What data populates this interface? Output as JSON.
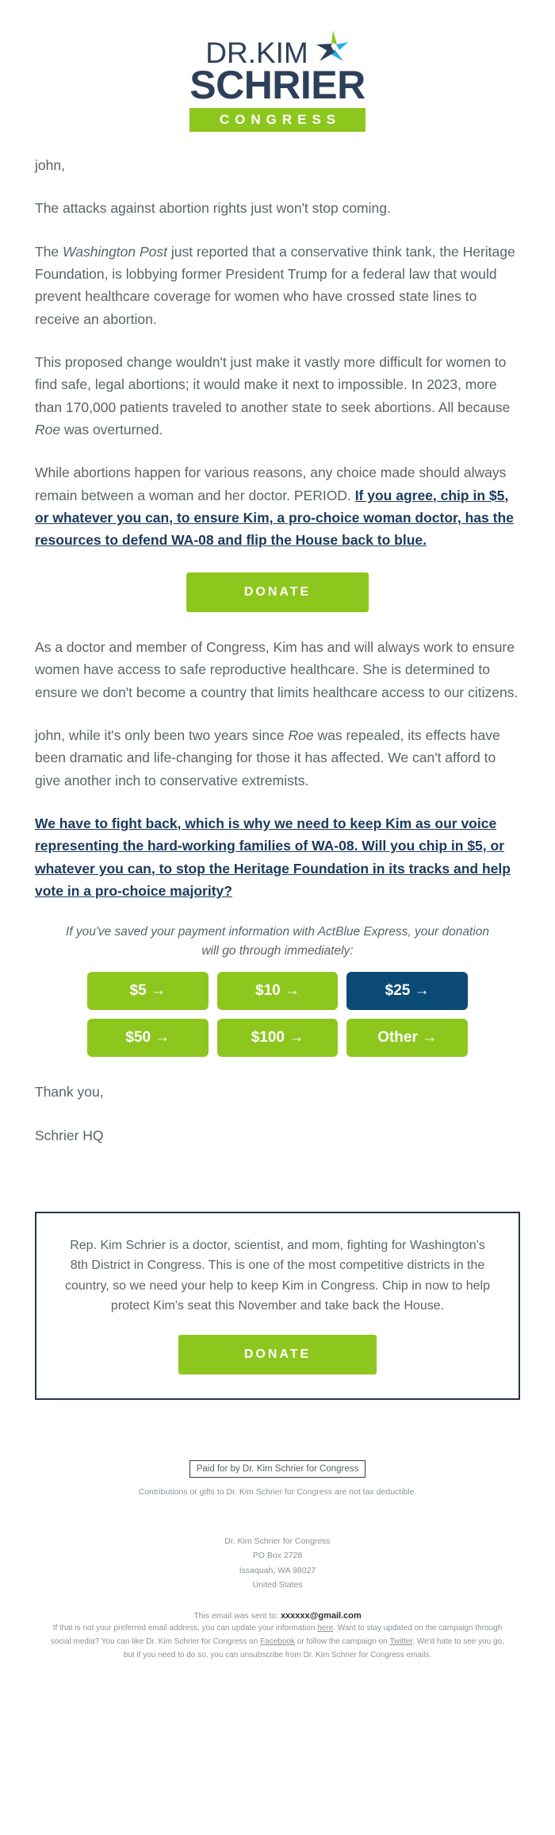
{
  "logo": {
    "line1": "DR.KIM",
    "line2": "SCHRIER",
    "bar": "CONGRESS",
    "star_icon": "star-icon",
    "navy": "#2d4059",
    "green": "#8dc71e",
    "cyan": "#29ABE2",
    "star_green": "#8dc71e"
  },
  "body": {
    "greeting": "john,",
    "p1": "The attacks against abortion rights just won't stop coming.",
    "p2_a": "The ",
    "p2_em": "Washington Post",
    "p2_b": " just reported that a conservative think tank, the Heritage Foundation, is lobbying former President Trump for a federal law that would prevent healthcare coverage for women who have crossed state lines to receive an abortion.",
    "p3_a": "This proposed change wouldn't just make it vastly more difficult for women to find safe, legal abortions; it would make it next to impossible. In 2023, more than 170,000 patients traveled to another state to seek abortions. All because ",
    "p3_em": "Roe",
    "p3_b": " was overturned.",
    "p4_a": "While abortions happen for various reasons, any choice made should always remain between a woman and her doctor. PERIOD. ",
    "p4_link": "If you agree, chip in $5, or whatever you can, to ensure Kim, a pro-choice woman doctor, has the resources to defend WA-08 and flip the House back to blue.",
    "p5": "As a doctor and member of Congress, Kim has and will always work to ensure women have access to safe reproductive healthcare. She is determined to ensure we don't become a country that limits healthcare access to our citizens.",
    "p6_a": "john, while it's only been two years since ",
    "p6_em": "Roe",
    "p6_b": " was repealed, its effects have been dramatic and life-changing for those it has affected. We can't afford to give another inch to conservative extremists.",
    "p7_link": "We have to fight back, which is why we need to keep Kim as our voice representing the hard-working families of WA-08. Will you chip in $5, or whatever you can, to stop the Heritage Foundation in its tracks and help vote in a pro-choice majority?",
    "signoff_1": "Thank you,",
    "signoff_2": "Schrier HQ"
  },
  "donate_button": {
    "label": "DONATE",
    "color": "#8dc71e"
  },
  "actblue": {
    "note": "If you've saved your payment information with ActBlue Express, your donation will go through immediately:",
    "amounts": [
      {
        "label": "$5 →",
        "highlighted": false
      },
      {
        "label": "$10 →",
        "highlighted": false
      },
      {
        "label": "$25 →",
        "highlighted": true
      },
      {
        "label": "$50 →",
        "highlighted": false
      },
      {
        "label": "$100 →",
        "highlighted": false
      },
      {
        "label": "Other →",
        "highlighted": false
      }
    ],
    "highlight_color": "#0b4a75"
  },
  "info_box": {
    "text": "Rep. Kim Schrier is a doctor, scientist, and mom, fighting for Washington's 8th District in Congress. This is one of the most competitive districts in the country, so we need your help to keep Kim in Congress. Chip in now to help protect Kim's seat this November and take back the House.",
    "button_label": "DONATE",
    "border_color": "#24364f"
  },
  "footer": {
    "paid_for": "Paid for by Dr. Kim Schrier for Congress",
    "tax_note": "Contributions or gifts to Dr. Kim Schrier for Congress are not tax deductible.",
    "address": [
      "Dr. Kim Schrier for Congress",
      "PO Box 2728",
      "Issaquah, WA 98027",
      "United States"
    ],
    "sent_to_label": "This email was sent to: ",
    "sent_to_email": "xxxxxx@gmail.com",
    "legal_1": "If that is not your preferred email address, you can update your information ",
    "legal_link_here": "here",
    "legal_2": ". Want to stay updated on the campaign through social media? You can like Dr. Kim Schrier for Congress on ",
    "legal_link_facebook": "Facebook",
    "legal_3": " or follow the campaign on ",
    "legal_link_twitter": "Twitter",
    "legal_4": ". We'd hate to see you go, but if you need to do so, you can unsubscribe from Dr. Kim Schrier for Congress emails."
  }
}
